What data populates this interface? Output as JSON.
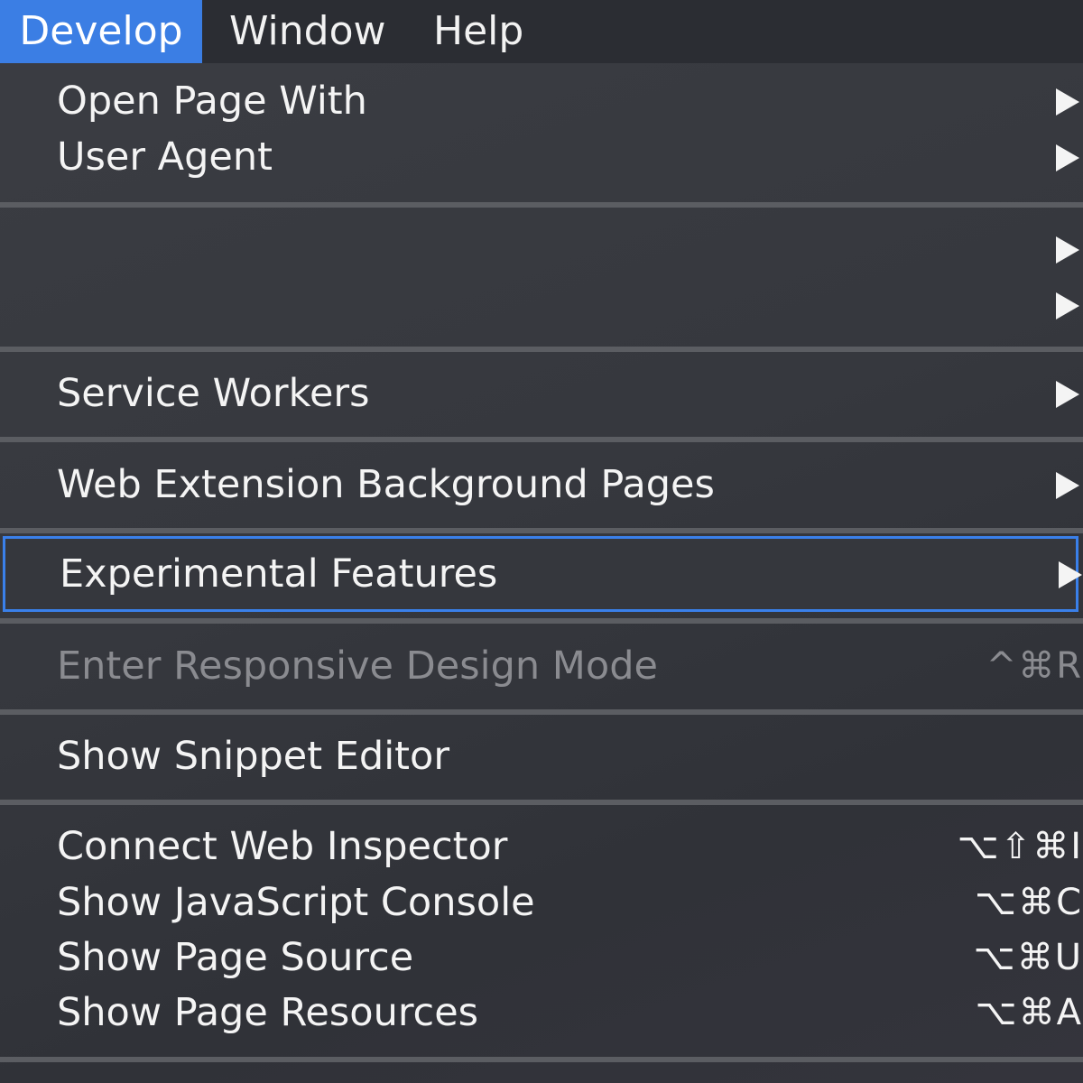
{
  "menubar": {
    "items": [
      {
        "label": "Develop",
        "active": true
      },
      {
        "label": "Window"
      },
      {
        "label": "Help"
      }
    ]
  },
  "menu": {
    "items": [
      {
        "label": "Open Page With",
        "submenu": true
      },
      {
        "label": "User Agent",
        "submenu": true
      },
      {
        "label": "",
        "submenu": true
      },
      {
        "label": "",
        "submenu": true
      },
      {
        "label": "Service Workers",
        "submenu": true
      },
      {
        "label": "Web Extension Background Pages",
        "submenu": true
      },
      {
        "label": "Experimental Features",
        "submenu": true,
        "highlighted": true
      },
      {
        "label": "Enter Responsive Design Mode",
        "shortcut": "^⌘R",
        "disabled": true
      },
      {
        "label": "Show Snippet Editor"
      },
      {
        "label": "Connect Web Inspector",
        "shortcut": "⌥⇧⌘I"
      },
      {
        "label": "Show JavaScript Console",
        "shortcut": "⌥⌘C"
      },
      {
        "label": "Show Page Source",
        "shortcut": "⌥⌘U"
      },
      {
        "label": "Show Page Resources",
        "shortcut": "⌥⌘A"
      }
    ]
  },
  "colors": {
    "accent": "#3b7ee4",
    "menu_background": "#36383e",
    "separator": "#5b5d62",
    "text": "#f4f4f4",
    "disabled_text": "#8a8b90"
  },
  "icons": {
    "submenu": "triangle-right-icon"
  }
}
